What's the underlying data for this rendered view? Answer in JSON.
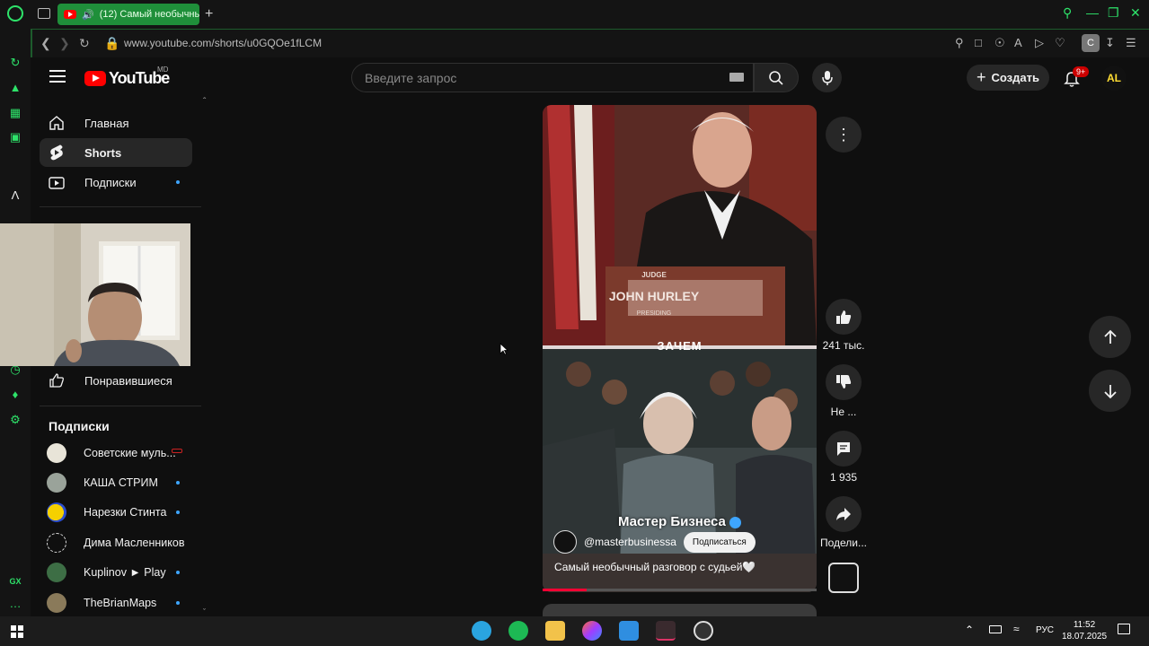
{
  "browser": {
    "active_tab_title": "(12) Самый необычны",
    "url": "www.youtube.com/shorts/u0GQOe1fLCM",
    "extension_badge": "C",
    "accent_color": "#2ee36a"
  },
  "header": {
    "logo_text": "YouTube",
    "country_code": "MD",
    "search_placeholder": "Введите запрос",
    "create_label": "Создать",
    "notification_badge": "9+",
    "avatar_initials": "AL"
  },
  "guide": {
    "items": [
      {
        "label": "Главная",
        "icon": "home-icon"
      },
      {
        "label": "Shorts",
        "icon": "shorts-icon",
        "active": true
      },
      {
        "label": "Подписки",
        "icon": "subscriptions-icon"
      }
    ],
    "liked_label": "Понравившиеся",
    "subscriptions_heading": "Подписки",
    "subscriptions": [
      {
        "name": "Советские муль...",
        "indicator": "live"
      },
      {
        "name": "КАША СТРИМ",
        "indicator": "dot"
      },
      {
        "name": "Нарезки Стинта",
        "indicator": "dot"
      },
      {
        "name": "Дима Масленников",
        "indicator": "none"
      },
      {
        "name": "Kuplinov ► Play",
        "indicator": "dot"
      },
      {
        "name": "TheBrianMaps",
        "indicator": "dot"
      }
    ]
  },
  "short": {
    "overlay_caption": "ЗАЧЕМ",
    "nameplate_top": "JUDGE",
    "nameplate_name": "JOHN HURLEY",
    "nameplate_bottom": "PRESIDING",
    "channel_display_name": "Мастер Бизнеса",
    "channel_handle": "@masterbusinessa",
    "subscribe_label": "Подписаться",
    "title": "Самый необычный разговор с судьей🤍",
    "progress": 0.16
  },
  "actions": {
    "likes": "241 тыс.",
    "dislike_label": "Не ...",
    "comments": "1 935",
    "share_label": "Подели..."
  },
  "taskbar": {
    "language": "РУС",
    "time": "11:52",
    "date": "18.07.2025"
  }
}
